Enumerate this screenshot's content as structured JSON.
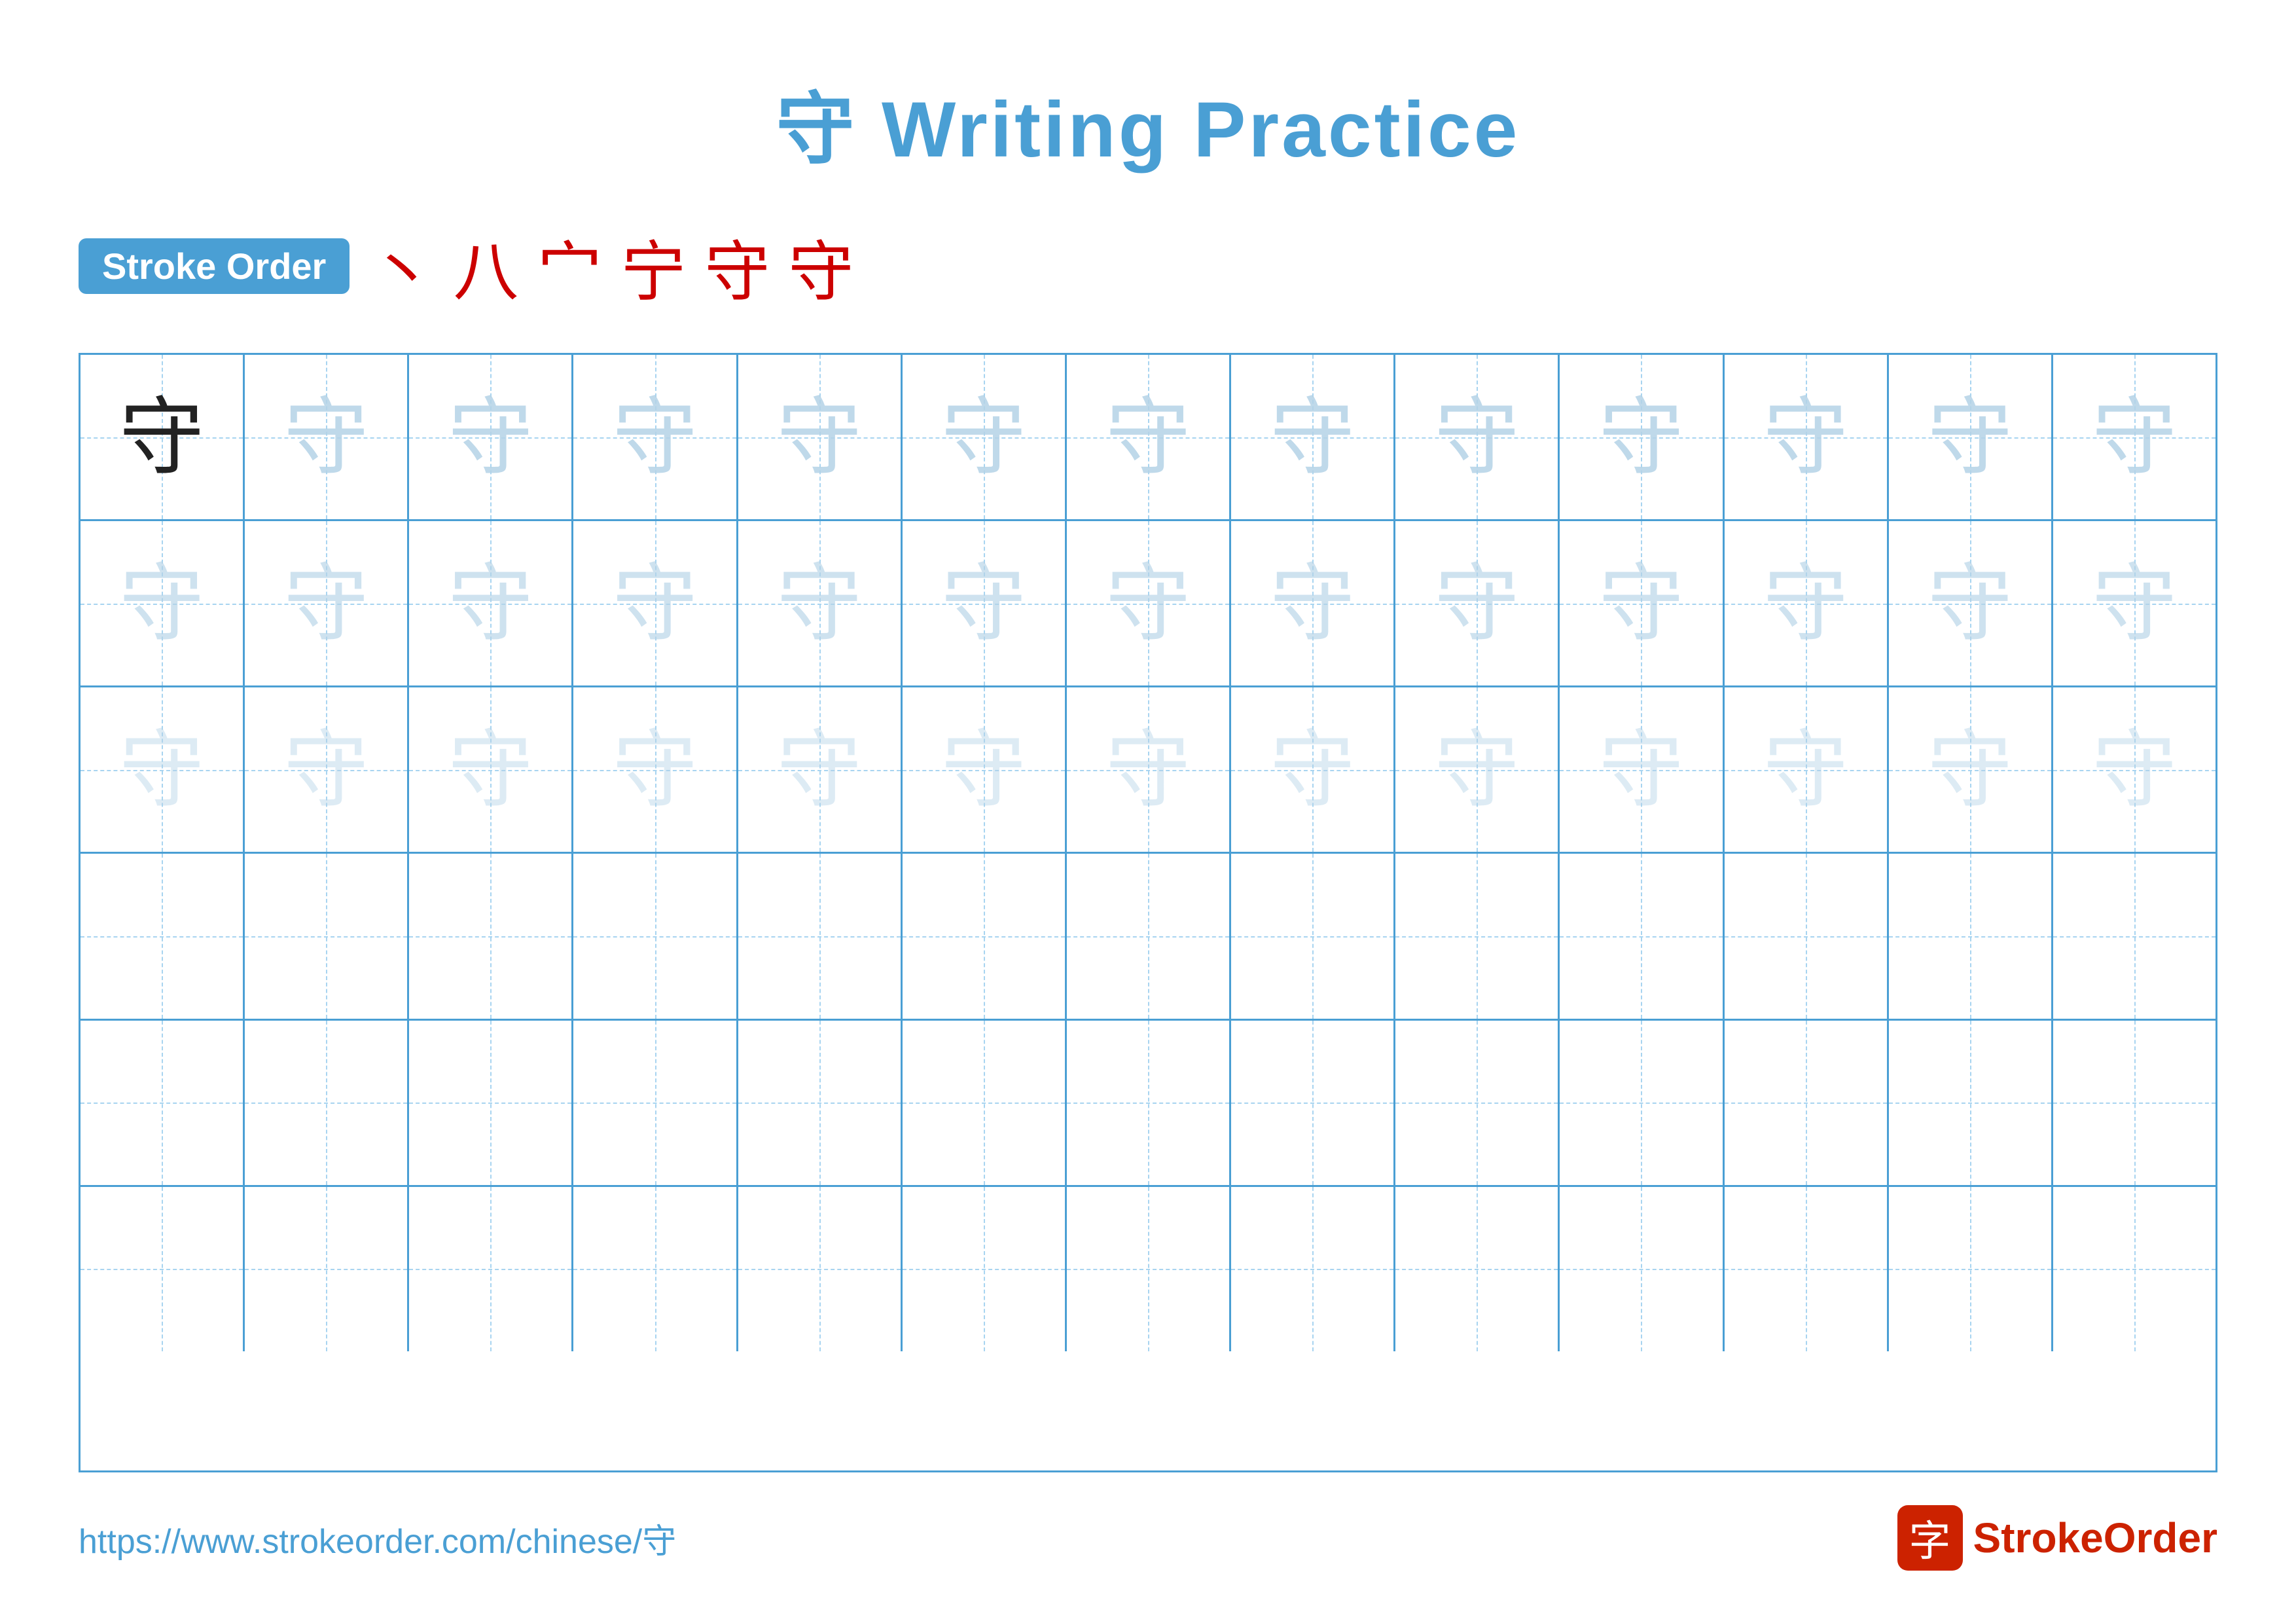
{
  "title": {
    "char": "守",
    "text": "Writing Practice",
    "full": "守 Writing Practice"
  },
  "stroke_order": {
    "badge_label": "Stroke Order",
    "strokes": [
      "丶",
      "八",
      "宀",
      "宁",
      "守",
      "守"
    ]
  },
  "grid": {
    "rows": 6,
    "cols": 13,
    "char": "守",
    "practice_char_rows": 3
  },
  "footer": {
    "url": "https://www.strokeorder.com/chinese/守",
    "logo_char": "字",
    "logo_text_1": "Stroke",
    "logo_text_2": "Order"
  }
}
